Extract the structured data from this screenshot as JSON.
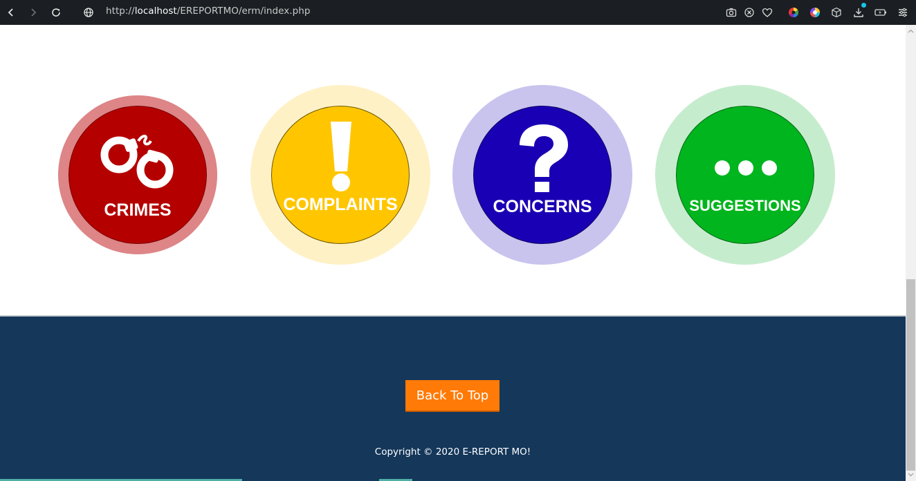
{
  "browser": {
    "url_prefix": "http://",
    "url_host": "localhost",
    "url_path": "/EREPORTMO/erm/index.php",
    "icons": [
      "back-icon",
      "forward-icon",
      "reload-icon",
      "globe-icon",
      "camera-icon",
      "block-icon",
      "heart-icon",
      "color-wheel-icon",
      "palette-icon",
      "cube-icon",
      "download-icon",
      "battery-icon",
      "menu-icon"
    ]
  },
  "categories": [
    {
      "label": "CRIMES",
      "icon": "handcuffs-icon",
      "ring_color": "#dd8587",
      "inner_color": "#b50000"
    },
    {
      "label": "COMPLAINTS",
      "icon": "exclamation-icon",
      "ring_color": "#fff1c6",
      "inner_color": "#ffc600"
    },
    {
      "label": "CONCERNS",
      "icon": "question-icon",
      "ring_color": "#c8c4ee",
      "inner_color": "#1a00b4"
    },
    {
      "label": "SUGGESTIONS",
      "icon": "ellipsis-icon",
      "ring_color": "#c6ecce",
      "inner_color": "#00b51e"
    }
  ],
  "footer": {
    "back_to_top": "Back To Top",
    "copyright": "Copyright © 2020 E-REPORT MO!",
    "background": "#14375a",
    "button_color": "#ff7a06"
  }
}
